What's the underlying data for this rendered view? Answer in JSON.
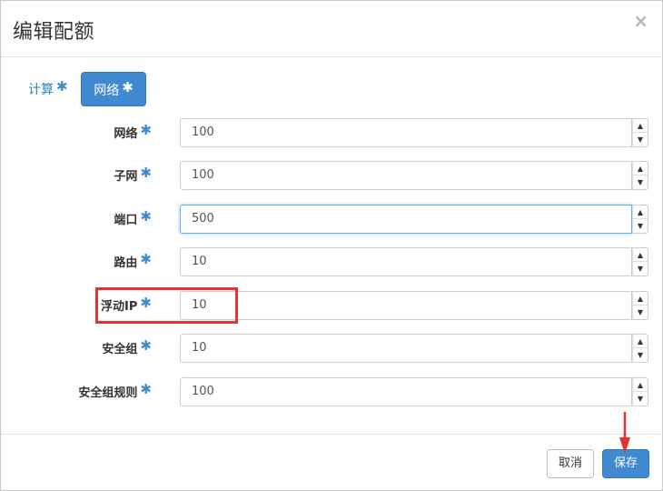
{
  "dialog": {
    "title": "编辑配额",
    "close_glyph": "×"
  },
  "tabs": [
    {
      "label": "计算",
      "required": "✱"
    },
    {
      "label": "网络",
      "required": "✱"
    }
  ],
  "fields": [
    {
      "label": "网络",
      "required": "✱",
      "value": "100"
    },
    {
      "label": "子网",
      "required": "✱",
      "value": "100"
    },
    {
      "label": "端口",
      "required": "✱",
      "value": "500"
    },
    {
      "label": "路由",
      "required": "✱",
      "value": "10"
    },
    {
      "label": "浮动IP",
      "required": "✱",
      "value": "10"
    },
    {
      "label": "安全组",
      "required": "✱",
      "value": "10"
    },
    {
      "label": "安全组规则",
      "required": "✱",
      "value": "100"
    }
  ],
  "spinner": {
    "up": "▲",
    "down": "▼"
  },
  "footer": {
    "cancel_label": "取消",
    "save_label": "保存"
  },
  "colors": {
    "accent": "#3f8ad0",
    "annotation": "#e8302f"
  },
  "icons": {
    "close": "close-icon",
    "spin_up": "caret-up-icon",
    "spin_down": "caret-down-icon",
    "annotation_arrow": "arrow-down-icon"
  }
}
